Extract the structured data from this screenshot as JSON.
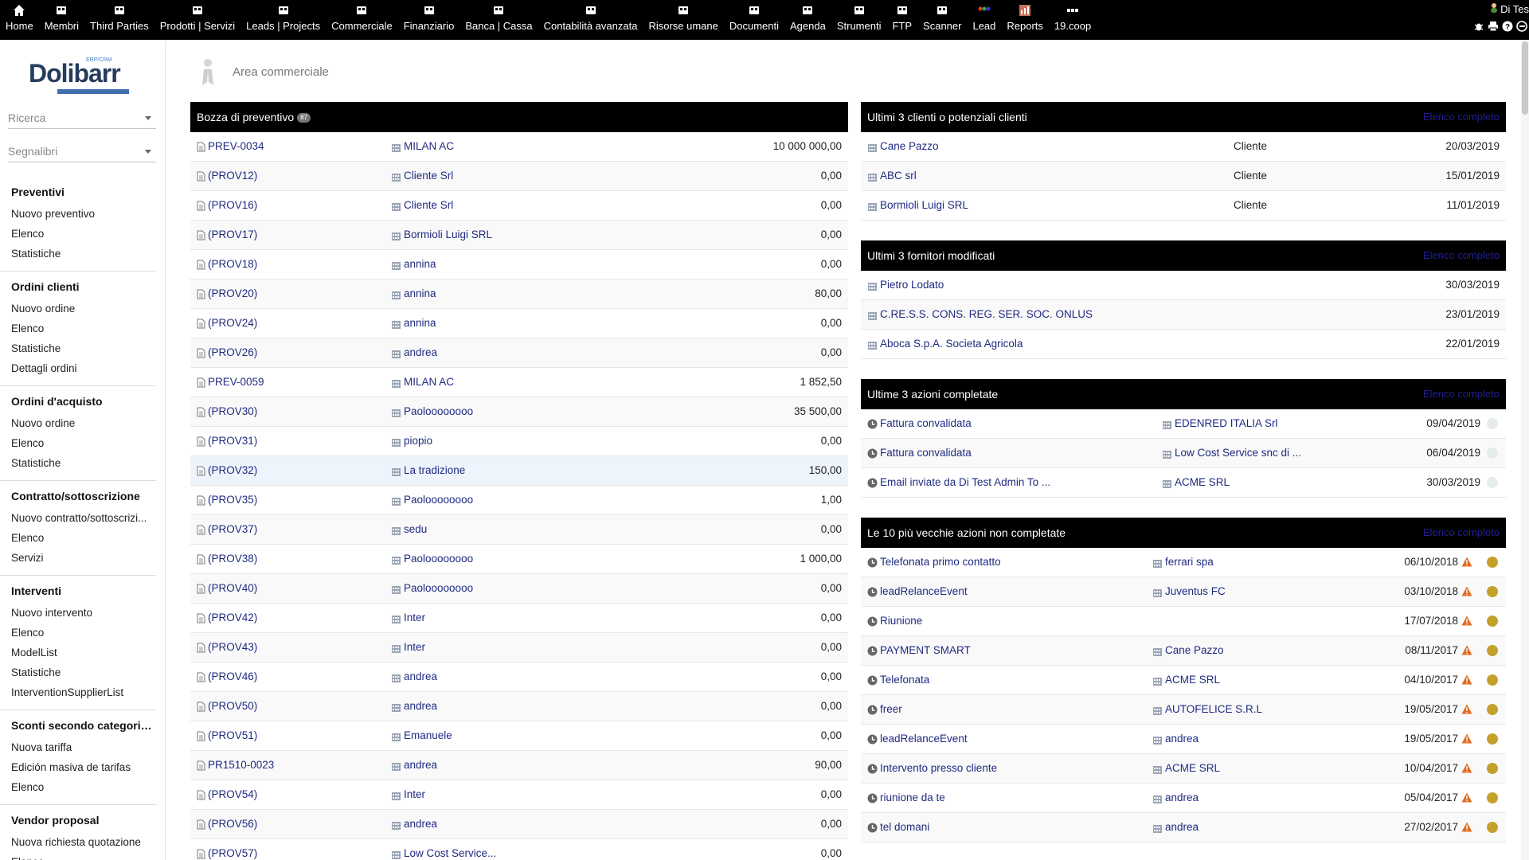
{
  "menu": [
    {
      "label": "Home",
      "icon": "home-icon"
    },
    {
      "label": "Membri",
      "icon": "members-icon"
    },
    {
      "label": "Third Parties",
      "icon": "third-parties-icon"
    },
    {
      "label": "Prodotti | Servizi",
      "icon": "products-icon"
    },
    {
      "label": "Leads | Projects",
      "icon": "projects-icon"
    },
    {
      "label": "Commerciale",
      "icon": "commercial-icon"
    },
    {
      "label": "Finanziario",
      "icon": "finance-icon"
    },
    {
      "label": "Banca | Cassa",
      "icon": "bank-icon"
    },
    {
      "label": "Contabilità avanzata",
      "icon": "accounting-icon"
    },
    {
      "label": "Risorse umane",
      "icon": "hr-icon"
    },
    {
      "label": "Documenti",
      "icon": "documents-icon"
    },
    {
      "label": "Agenda",
      "icon": "agenda-icon"
    },
    {
      "label": "Strumenti",
      "icon": "tools-icon"
    },
    {
      "label": "FTP",
      "icon": "ftp-icon"
    },
    {
      "label": "Scanner",
      "icon": "scanner-icon"
    },
    {
      "label": "Lead",
      "icon": "lead-icon"
    },
    {
      "label": "Reports",
      "icon": "reports-icon"
    },
    {
      "label": "19.coop",
      "icon": "coop-icon"
    }
  ],
  "user": {
    "name": "Di Tes"
  },
  "sidebar": {
    "logo_text": "Dolibarr",
    "logo_sub": "ERP/CRM",
    "search_label": "Ricerca",
    "bookmarks_label": "Segnalibri",
    "sections": [
      {
        "title": "Preventivi",
        "links": [
          "Nuovo preventivo",
          "Elenco",
          "Statistiche"
        ]
      },
      {
        "title": "Ordini clienti",
        "links": [
          "Nuovo ordine",
          "Elenco",
          "Statistiche",
          "Dettagli ordini"
        ]
      },
      {
        "title": "Ordini d'acquisto",
        "links": [
          "Nuovo ordine",
          "Elenco",
          "Statistiche"
        ]
      },
      {
        "title": "Contratto/sottoscrizione",
        "links": [
          "Nuovo contratto/sottoscrizi...",
          "Elenco",
          "Servizi"
        ]
      },
      {
        "title": "Interventi",
        "links": [
          "Nuovo intervento",
          "Elenco",
          "ModelList",
          "Statistiche",
          "InterventionSupplierList"
        ]
      },
      {
        "title": "Sconti secondo categorie...",
        "links": [
          "Nuova tariffa",
          "Edición masiva de tarifas",
          "Elenco"
        ]
      },
      {
        "title": "Vendor proposal",
        "links": [
          "Nuova richiesta quotazione",
          "Elenco"
        ]
      }
    ]
  },
  "page": {
    "title": "Area commerciale"
  },
  "drafts": {
    "title": "Bozza di preventivo",
    "count": "87",
    "rows": [
      {
        "ref": "PREV-0034",
        "company": "MILAN AC",
        "amount": "10 000 000,00"
      },
      {
        "ref": "(PROV12)",
        "company": "Cliente Srl",
        "amount": "0,00"
      },
      {
        "ref": "(PROV16)",
        "company": "Cliente Srl",
        "amount": "0,00"
      },
      {
        "ref": "(PROV17)",
        "company": "Bormioli Luigi SRL",
        "amount": "0,00"
      },
      {
        "ref": "(PROV18)",
        "company": "annina",
        "amount": "0,00"
      },
      {
        "ref": "(PROV20)",
        "company": "annina",
        "amount": "80,00"
      },
      {
        "ref": "(PROV24)",
        "company": "annina",
        "amount": "0,00"
      },
      {
        "ref": "(PROV26)",
        "company": "andrea",
        "amount": "0,00"
      },
      {
        "ref": "PREV-0059",
        "company": "MILAN AC",
        "amount": "1 852,50"
      },
      {
        "ref": "(PROV30)",
        "company": "Paoloooooooo",
        "amount": "35 500,00"
      },
      {
        "ref": "(PROV31)",
        "company": "piopio",
        "amount": "0,00"
      },
      {
        "ref": "(PROV32)",
        "company": "La tradizione",
        "amount": "150,00"
      },
      {
        "ref": "(PROV35)",
        "company": "Paoloooooooo",
        "amount": "1,00"
      },
      {
        "ref": "(PROV37)",
        "company": "sedu",
        "amount": "0,00"
      },
      {
        "ref": "(PROV38)",
        "company": "Paoloooooooo",
        "amount": "1 000,00"
      },
      {
        "ref": "(PROV40)",
        "company": "Paoloooooooo",
        "amount": "0,00"
      },
      {
        "ref": "(PROV42)",
        "company": "Inter",
        "amount": "0,00"
      },
      {
        "ref": "(PROV43)",
        "company": "Inter",
        "amount": "0,00"
      },
      {
        "ref": "(PROV46)",
        "company": "andrea",
        "amount": "0,00"
      },
      {
        "ref": "(PROV50)",
        "company": "andrea",
        "amount": "0,00"
      },
      {
        "ref": "(PROV51)",
        "company": "Emanuele",
        "amount": "0,00"
      },
      {
        "ref": "PR1510-0023",
        "company": "andrea",
        "amount": "90,00"
      },
      {
        "ref": "(PROV54)",
        "company": "Inter",
        "amount": "0,00"
      },
      {
        "ref": "(PROV56)",
        "company": "andrea",
        "amount": "0,00"
      },
      {
        "ref": "(PROV57)",
        "company": "Low Cost Service...",
        "amount": "0,00"
      }
    ]
  },
  "clients": {
    "title": "Ultimi 3 clienti o potenziali clienti",
    "full_list": "Elenco completo",
    "rows": [
      {
        "name": "Cane Pazzo",
        "type": "Cliente",
        "date": "20/03/2019"
      },
      {
        "name": "ABC srl",
        "type": "Cliente",
        "date": "15/01/2019"
      },
      {
        "name": "Bormioli Luigi SRL",
        "type": "Cliente",
        "date": "11/01/2019"
      }
    ]
  },
  "suppliers": {
    "title": "Ultimi 3 fornitori modificati",
    "full_list": "Elenco completo",
    "rows": [
      {
        "name": "Pietro Lodato",
        "date": "30/03/2019"
      },
      {
        "name": "C.RE.S.S. CONS. REG. SER. SOC. ONLUS",
        "date": "23/01/2019"
      },
      {
        "name": "Aboca S.p.A. Societa Agricola",
        "date": "22/01/2019"
      }
    ]
  },
  "done_actions": {
    "title": "Ultime 3 azioni completate",
    "full_list": "Elenco completo",
    "rows": [
      {
        "label": "Fattura convalidata",
        "company": "EDENRED ITALIA Srl",
        "date": "09/04/2019"
      },
      {
        "label": "Fattura convalidata",
        "company": "Low Cost Service snc di ...",
        "date": "06/04/2019"
      },
      {
        "label": "Email inviate da Di Test Admin To ...",
        "company": "ACME SRL",
        "date": "30/03/2019"
      }
    ]
  },
  "todo_actions": {
    "title": "Le 10 più vecchie azioni non completate",
    "full_list": "Elenco completo",
    "rows": [
      {
        "label": "Telefonata primo contatto",
        "company": "ferrari spa",
        "date": "06/10/2018"
      },
      {
        "label": "leadRelanceEvent",
        "company": "Juventus FC",
        "date": "03/10/2018"
      },
      {
        "label": "Riunione",
        "company": "",
        "date": "17/07/2018"
      },
      {
        "label": "PAYMENT SMART",
        "company": "Cane Pazzo",
        "date": "08/11/2017"
      },
      {
        "label": "Telefonata",
        "company": "ACME SRL",
        "date": "04/10/2017"
      },
      {
        "label": "freer",
        "company": "AUTOFELICE S.R.L",
        "date": "19/05/2017"
      },
      {
        "label": "leadRelanceEvent",
        "company": "andrea",
        "date": "19/05/2017"
      },
      {
        "label": "Intervento presso cliente",
        "company": "ACME SRL",
        "date": "10/04/2017"
      },
      {
        "label": "riunione da te",
        "company": "andrea",
        "date": "05/04/2017"
      },
      {
        "label": "tel domani",
        "company": "andrea",
        "date": "27/02/2017"
      }
    ]
  },
  "colors": {
    "header_bg": "#000000",
    "link": "#1f2a80",
    "warning": "#e06c1f",
    "status_dot": "#c4a12a",
    "done_dot": "#e6ece9",
    "full_list": "#231f92"
  }
}
